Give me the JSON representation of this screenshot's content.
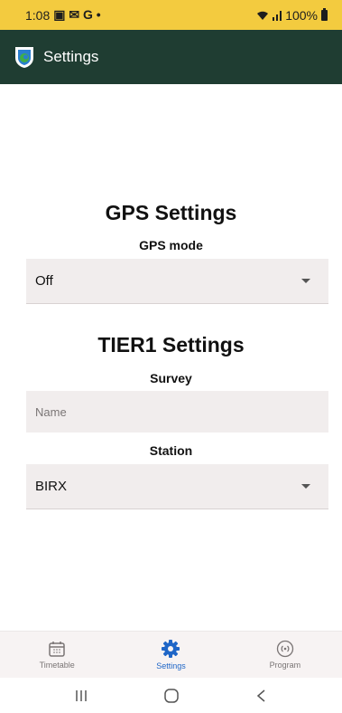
{
  "status_bar": {
    "time": "1:08",
    "notification_icons": "▣ ✉ G •",
    "battery_text": "100%"
  },
  "app_bar": {
    "title": "Settings",
    "logo_icon": "app-logo-icon"
  },
  "gps_section": {
    "title": "GPS Settings",
    "mode_label": "GPS mode",
    "mode_value": "Off"
  },
  "tier1_section": {
    "title": "TIER1 Settings",
    "survey_label": "Survey",
    "survey_placeholder": "Name",
    "station_label": "Station",
    "station_value": "BIRX"
  },
  "bottom_nav": {
    "items": [
      {
        "label": "Timetable",
        "icon": "calendar-icon",
        "active": false
      },
      {
        "label": "Settings",
        "icon": "gear-icon",
        "active": true
      },
      {
        "label": "Program",
        "icon": "broadcast-icon",
        "active": false
      }
    ]
  },
  "colors": {
    "status_bar": "#f3cb3f",
    "app_bar": "#1f3d32",
    "accent": "#1f66c7",
    "field_bg": "#f1eded"
  }
}
